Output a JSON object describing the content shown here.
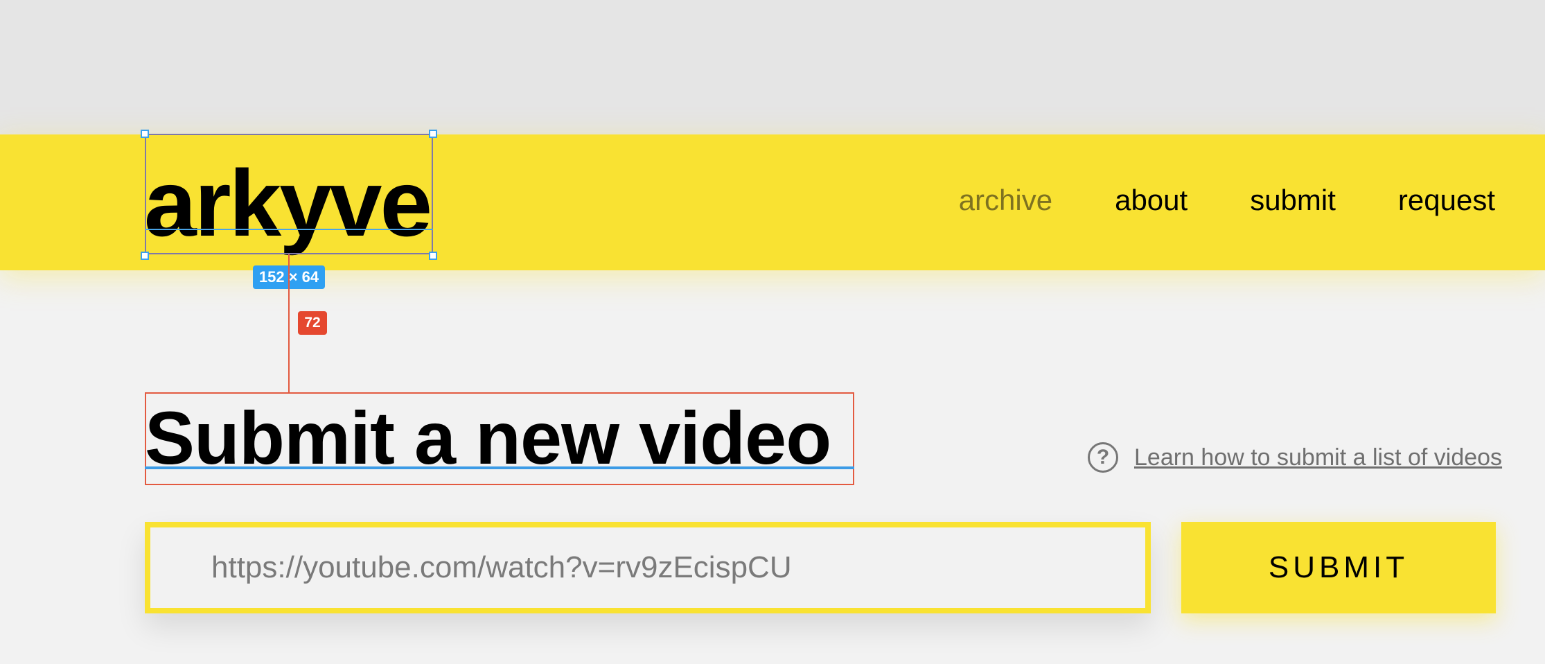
{
  "header": {
    "logo": "arkyve",
    "nav": [
      {
        "label": "archive",
        "active": true
      },
      {
        "label": "about",
        "active": false
      },
      {
        "label": "submit",
        "active": false
      },
      {
        "label": "request",
        "active": false
      }
    ]
  },
  "inspector": {
    "selection_size": "152 × 64",
    "spacing": "72"
  },
  "main": {
    "title": "Submit a new video",
    "help_link": "Learn how to submit a list of videos",
    "help_icon": "?",
    "url_input": {
      "placeholder": "https://youtube.com/watch?v=rv9zEcispCU",
      "value": ""
    },
    "submit_label": "SUBMIT"
  },
  "colors": {
    "brand_yellow": "#f9e232",
    "active_nav": "#7e7220",
    "inspector_blue": "#2fa0f2",
    "inspector_red": "#e5482f"
  }
}
